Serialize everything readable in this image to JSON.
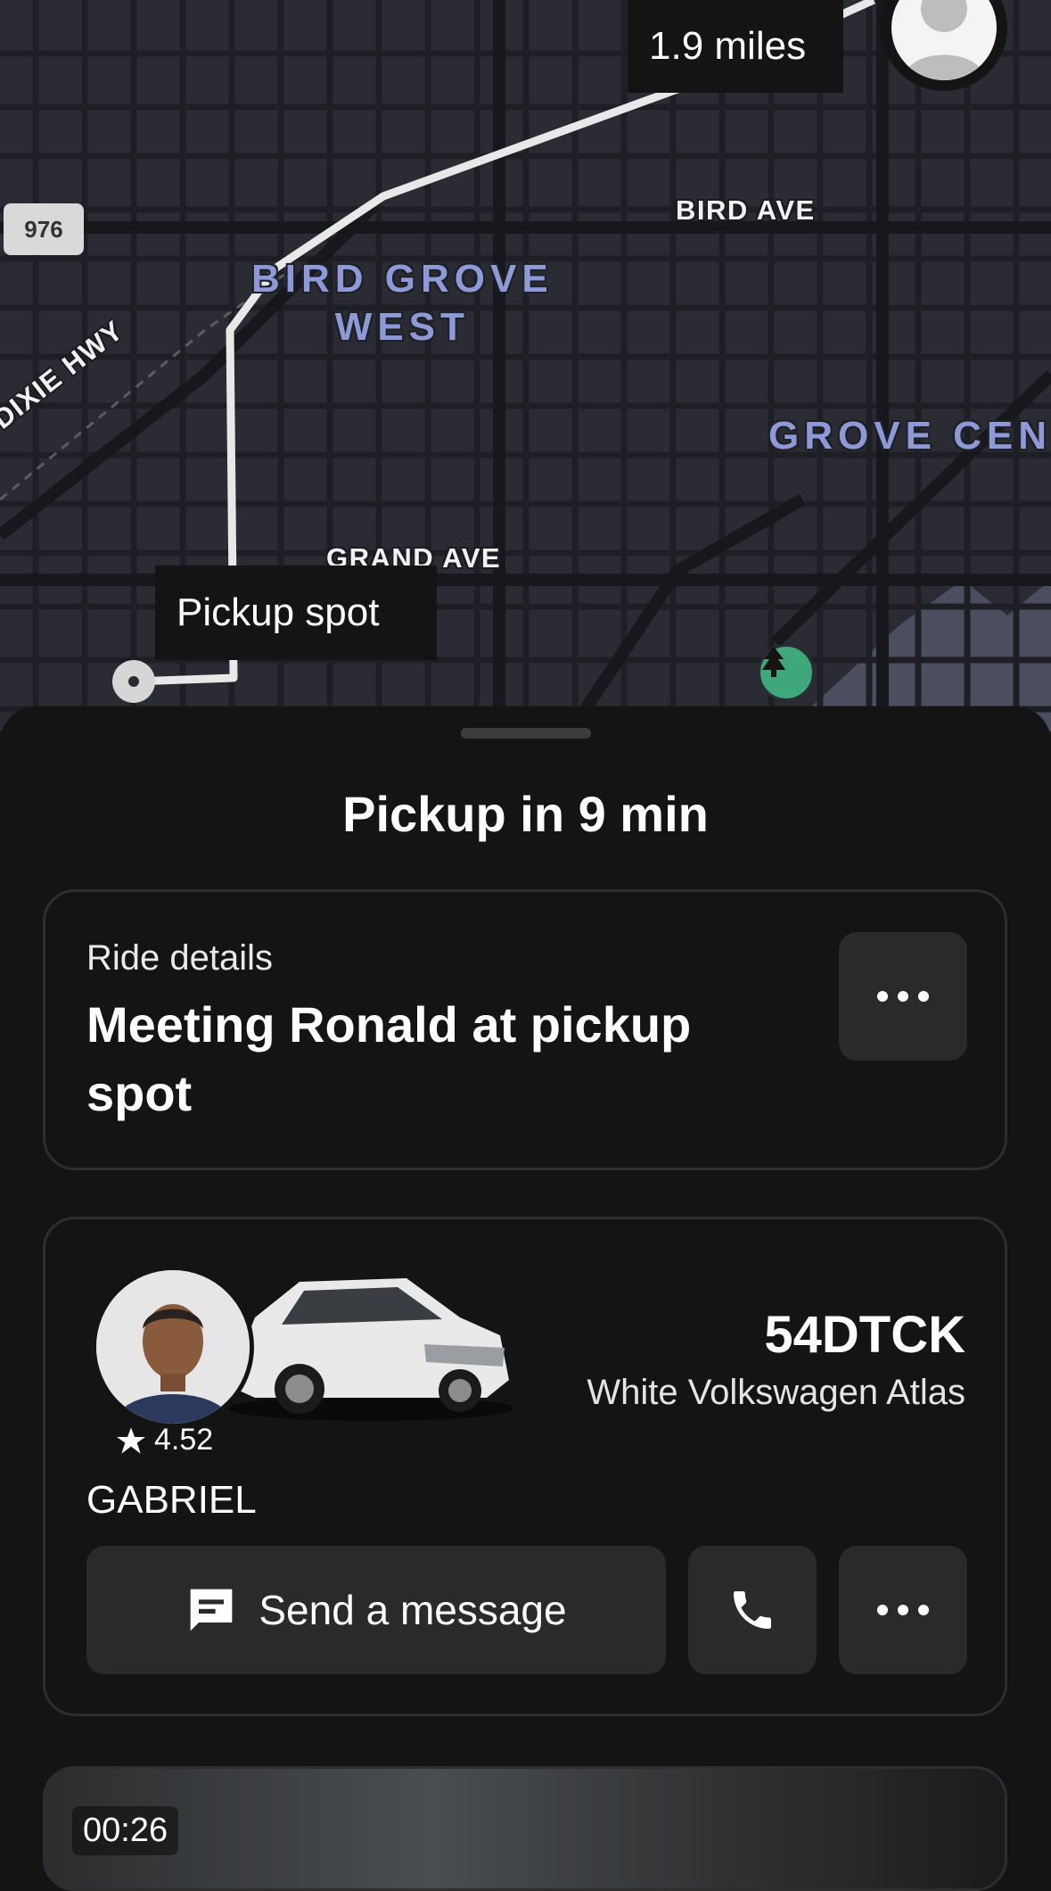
{
  "map": {
    "distance_label": "1.9 miles",
    "pickup_label": "Pickup spot",
    "route_shield": "976",
    "neighborhoods": {
      "bird_grove_west": "BIRD GROVE\nWEST",
      "grove_center": "GROVE CEN"
    },
    "streets": {
      "bird_ave": "BIRD AVE",
      "grand_ave": "GRAND AVE",
      "dixie_hwy": "S DIXIE HWY"
    }
  },
  "sheet": {
    "title": "Pickup in 9 min",
    "ride_details": {
      "caption": "Ride details",
      "main": "Meeting Ronald at pickup spot"
    },
    "driver": {
      "rating": "4.52",
      "plate": "54DTCK",
      "vehicle": "White Volkswagen Atlas",
      "name": "GABRIEL",
      "message_label": "Send a message"
    },
    "video": {
      "time": "00:26"
    }
  },
  "colors": {
    "map_bg": "#2b2c33",
    "route": "#e8e8e8",
    "neighborhood": "#8e9ad8",
    "sheet_bg": "#141414",
    "park_pin": "#3ea87a"
  }
}
